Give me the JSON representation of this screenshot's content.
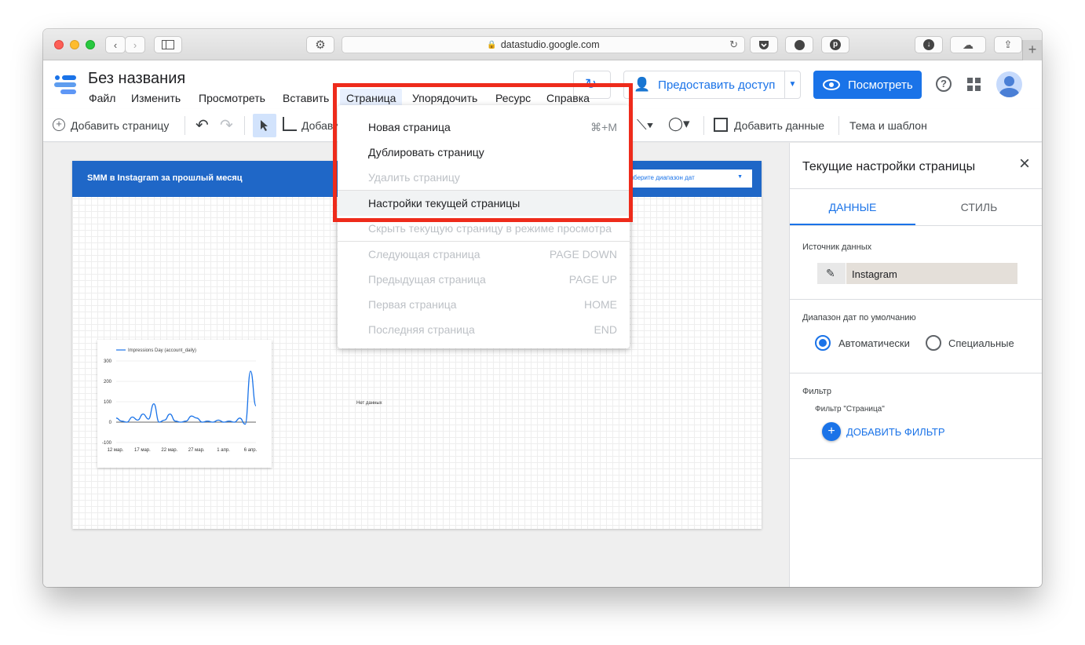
{
  "browser": {
    "url": "datastudio.google.com",
    "new_tab": "+"
  },
  "app": {
    "title": "Без названия",
    "menus": [
      "Файл",
      "Изменить",
      "Просмотреть",
      "Вставить",
      "Страница",
      "Упорядочить",
      "Ресурс",
      "Справка"
    ],
    "share_label": "Предоставить доступ",
    "view_label": "Посмотреть"
  },
  "toolbar": {
    "add_page": "Добавить страницу",
    "add_chart_partial": "Добави",
    "add_data": "Добавить данные",
    "theme": "Тема и шаблон"
  },
  "page_menu": {
    "items": [
      {
        "label": "Новая страница",
        "shortcut": "⌘+M",
        "enabled": true
      },
      {
        "label": "Дублировать страницу",
        "shortcut": "",
        "enabled": true
      },
      {
        "label": "Удалить страницу",
        "shortcut": "",
        "enabled": false
      },
      {
        "label": "Настройки текущей страницы",
        "shortcut": "",
        "enabled": true,
        "highlighted": true
      },
      {
        "label": "Скрыть текущую страницу в режиме просмотра",
        "shortcut": "",
        "enabled": false
      },
      {
        "label": "Следующая страница",
        "shortcut": "PAGE DOWN",
        "enabled": false
      },
      {
        "label": "Предыдущая страница",
        "shortcut": "PAGE UP",
        "enabled": false
      },
      {
        "label": "Первая страница",
        "shortcut": "HOME",
        "enabled": false
      },
      {
        "label": "Последняя страница",
        "shortcut": "END",
        "enabled": false
      }
    ]
  },
  "report": {
    "header_title": "SMM в Instagram за прошлый месяц",
    "date_range_placeholder": "Выберите диапазон дат",
    "no_data": "Нет данных"
  },
  "chart_data": {
    "type": "line",
    "legend": "Impressions Day (account_daily)",
    "x_ticks": [
      "12 мар.",
      "17 мар.",
      "22 мар.",
      "27 мар.",
      "1 апр.",
      "6 апр."
    ],
    "y_ticks": [
      "300",
      "200",
      "100",
      "0",
      "-100"
    ],
    "ylim": [
      -100,
      300
    ],
    "series": [
      {
        "name": "Impressions Day (account_daily)",
        "x_index": [
          0,
          1,
          2,
          3,
          4,
          5,
          6,
          7,
          8,
          9,
          10,
          11,
          12,
          13,
          14,
          15,
          16,
          17,
          18,
          19,
          20,
          21,
          22,
          23,
          24,
          25,
          26
        ],
        "values": [
          20,
          5,
          0,
          25,
          10,
          40,
          15,
          90,
          0,
          10,
          40,
          5,
          0,
          5,
          30,
          20,
          0,
          5,
          0,
          10,
          0,
          5,
          0,
          20,
          -10,
          250,
          80
        ]
      }
    ],
    "line_color": "#1a73e8"
  },
  "side_panel": {
    "title": "Текущие настройки страницы",
    "tab_data": "ДАННЫЕ",
    "tab_style": "СТИЛЬ",
    "source_label": "Источник данных",
    "source_value": "Instagram",
    "date_label": "Диапазон дат по умолчанию",
    "radio_auto": "Автоматически",
    "radio_custom": "Специальные",
    "filter_label": "Фильтр",
    "filter_sub": "Фильтр \"Страница\"",
    "add_filter": "ДОБАВИТЬ ФИЛЬТР"
  }
}
